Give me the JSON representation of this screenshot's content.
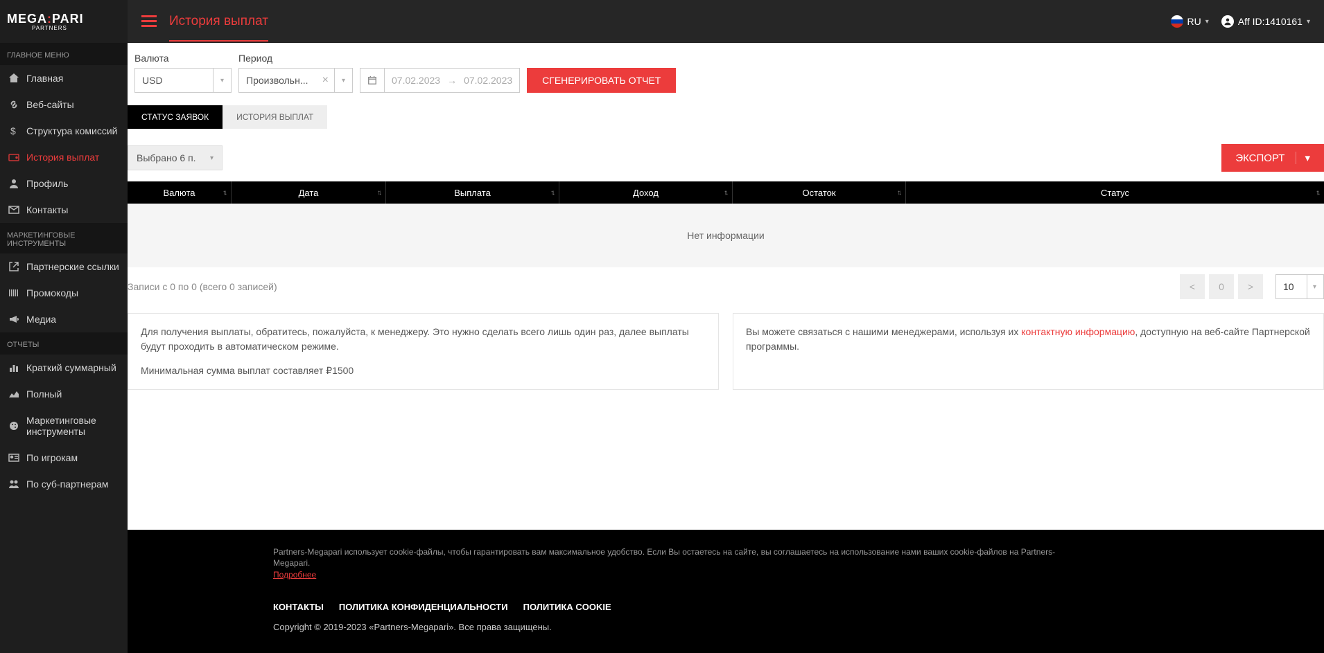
{
  "logo": {
    "main": "MEGA",
    "accent": ":",
    "rest": "PARI",
    "sub": "PARTNERS"
  },
  "topbar": {
    "title": "История выплат",
    "lang": "RU",
    "user": "Aff ID:1410161"
  },
  "sidebar": {
    "sections": [
      {
        "title": "ГЛАВНОЕ МЕНЮ",
        "items": [
          {
            "label": "Главная"
          },
          {
            "label": "Веб-сайты"
          },
          {
            "label": "Структура комиссий"
          },
          {
            "label": "История выплат"
          },
          {
            "label": "Профиль"
          },
          {
            "label": "Контакты"
          }
        ]
      },
      {
        "title": "МАРКЕТИНГОВЫЕ ИНСТРУМЕНТЫ",
        "items": [
          {
            "label": "Партнерские ссылки"
          },
          {
            "label": "Промокоды"
          },
          {
            "label": "Медиа"
          }
        ]
      },
      {
        "title": "ОТЧЕТЫ",
        "items": [
          {
            "label": "Краткий суммарный"
          },
          {
            "label": "Полный"
          },
          {
            "label": "Маркетинговые инструменты"
          },
          {
            "label": "По игрокам"
          },
          {
            "label": "По суб-партнерам"
          }
        ]
      }
    ]
  },
  "filters": {
    "currency_label": "Валюта",
    "currency_value": "USD",
    "period_label": "Период",
    "period_value": "Произвольн...",
    "date_from": "07.02.2023",
    "date_to": "07.02.2023",
    "generate_btn": "СГЕНЕРИРОВАТЬ ОТЧЕТ"
  },
  "tabs": {
    "t1": "СТАТУС ЗАЯВОК",
    "t2": "ИСТОРИЯ ВЫПЛАТ"
  },
  "toolbar": {
    "columns_sel": "Выбрано 6 п.",
    "export_btn": "ЭКСПОРТ"
  },
  "table": {
    "headers": [
      "Валюта",
      "Дата",
      "Выплата",
      "Доход",
      "Остаток",
      "Статус"
    ],
    "no_data": "Нет информации"
  },
  "pagination": {
    "info": "Записи с 0 по 0 (всего 0 записей)",
    "prev": "<",
    "cur": "0",
    "next": ">",
    "size": "10"
  },
  "panels": {
    "p1_line1": "Для получения выплаты, обратитесь, пожалуйста, к менеджеру. Это нужно сделать всего лишь один раз, далее выплаты будут проходить в автоматическом режиме.",
    "p1_line2": "Минимальная сумма выплат составляет ₽1500",
    "p2_before": "Вы можете связаться с нашими менеджерами, используя их ",
    "p2_link": "контактную информацию",
    "p2_after": ", доступную на веб-сайте Партнерской программы."
  },
  "footer": {
    "cookie": "Partners-Megapari использует cookie-файлы, чтобы гарантировать вам максимальное удобство. Если Вы остаетесь на сайте, вы соглашаетесь на использование нами ваших cookie-файлов на Partners-Megapari. ",
    "cookie_link": "Подробнее",
    "links": [
      "КОНТАКТЫ",
      "ПОЛИТИКА КОНФИДЕНЦИАЛЬНОСТИ",
      "ПОЛИТИКА COOKIE"
    ],
    "copyright": "Copyright © 2019-2023 «Partners-Megapari». Все права защищены."
  }
}
